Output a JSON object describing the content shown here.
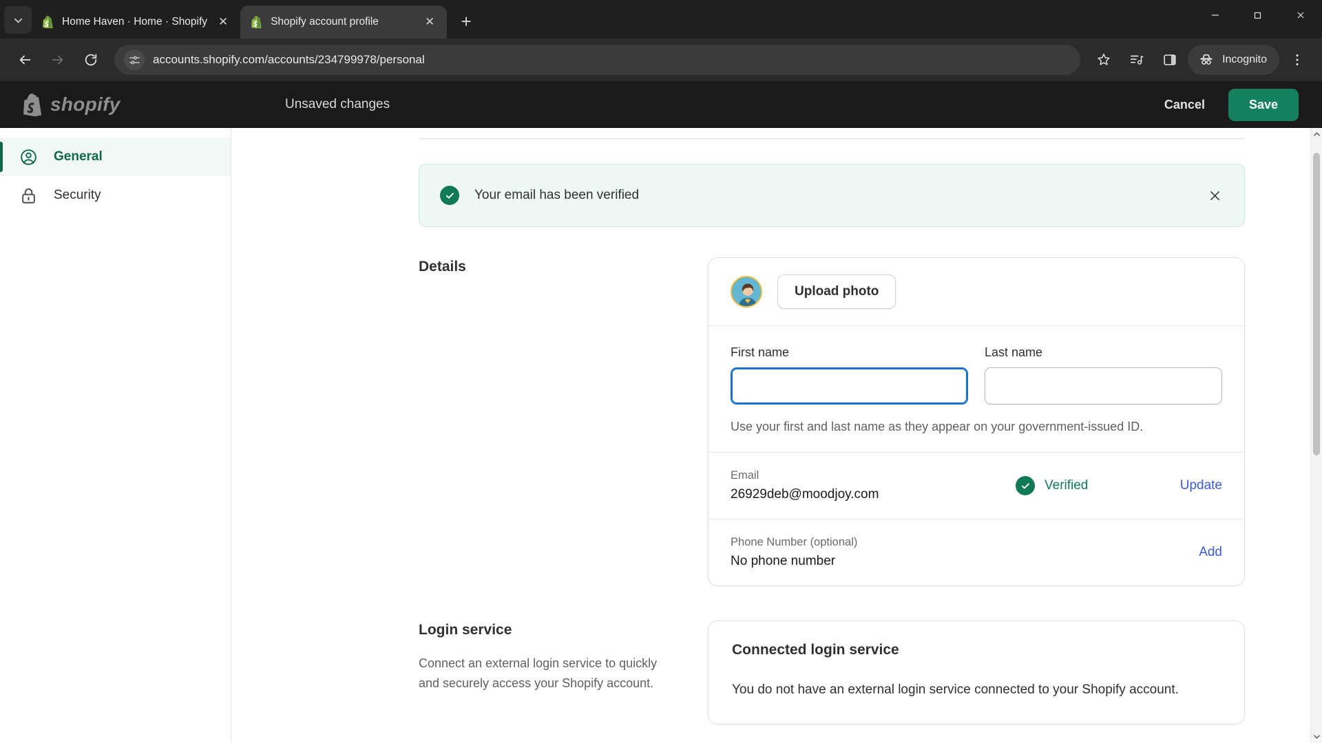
{
  "browser": {
    "tabs": [
      {
        "title": "Home Haven · Home · Shopify",
        "active": false
      },
      {
        "title": "Shopify account profile",
        "active": true
      }
    ],
    "tab_close_label": "✕",
    "new_tab_label": "+",
    "tab_search_icon": "chevron-down-icon",
    "window_minimize": "—",
    "window_maximize": "❐",
    "window_close": "✕",
    "url": "accounts.shopify.com/accounts/234799978/personal",
    "back_label": "←",
    "forward_label": "→",
    "reload_label": "⟳",
    "incognito_label": "Incognito",
    "menu_label": "⋮"
  },
  "header": {
    "brand": "shopify",
    "status": "Unsaved changes",
    "cancel_label": "Cancel",
    "save_label": "Save"
  },
  "sidebar": {
    "items": [
      {
        "label": "General",
        "icon": "user-circle-icon",
        "active": true
      },
      {
        "label": "Security",
        "icon": "lock-icon",
        "active": false
      }
    ]
  },
  "banner": {
    "message": "Your email has been verified",
    "close_label": "✕",
    "icon": "check-circle-icon"
  },
  "details": {
    "section_title": "Details",
    "upload_photo_label": "Upload photo",
    "first_name": {
      "label": "First name",
      "value": "",
      "placeholder": ""
    },
    "last_name": {
      "label": "Last name",
      "value": "",
      "placeholder": ""
    },
    "helper_text": "Use your first and last name as they appear on your government-issued ID.",
    "email": {
      "label": "Email",
      "value": "26929deb@moodjoy.com",
      "status": "Verified",
      "action": "Update"
    },
    "phone": {
      "label": "Phone Number (optional)",
      "value": "No phone number",
      "action": "Add"
    }
  },
  "login_service": {
    "section_title": "Login service",
    "section_desc": "Connect an external login service to quickly and securely access your Shopify account.",
    "card_title": "Connected login service",
    "card_body": "You do not have an external login service connected to your Shopify account."
  },
  "colors": {
    "brand_green": "#14805e",
    "accent_link": "#3b5bdb",
    "focus_blue": "#1773cf",
    "success_green": "#0f7a55"
  }
}
